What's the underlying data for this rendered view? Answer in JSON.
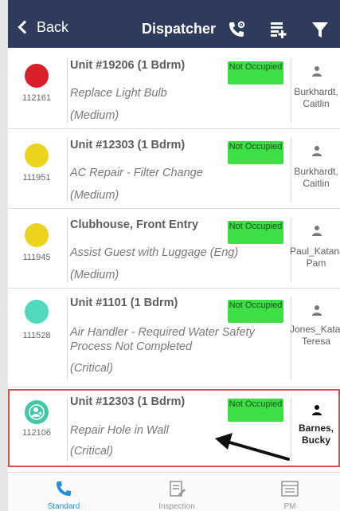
{
  "header": {
    "back_label": "Back",
    "title": "Dispatcher"
  },
  "colors": {
    "header_bg": "#2f3b5c",
    "badge_green": "#3ddf47",
    "accent_blue": "#1f8fdf",
    "selection_red": "#e14a4a"
  },
  "work_orders": [
    {
      "id": "112161",
      "location": "Unit #19206 (1 Bdrm)",
      "description": "Replace Light Bulb",
      "priority": "(Medium)",
      "status": "Not Occupied",
      "assignee": "Burkhardt, Caitlin",
      "dot_color": "#d9202a"
    },
    {
      "id": "111951",
      "location": "Unit #12303 (1 Bdrm)",
      "description": "AC Repair - Filter Change",
      "priority": "(Medium)",
      "status": "Not Occupied",
      "assignee": "Burkhardt, Caitlin",
      "dot_color": "#ecd31c"
    },
    {
      "id": "111945",
      "location": "Clubhouse, Front Entry",
      "description": "Assist Guest with Luggage (Eng)",
      "priority": "(Medium)",
      "status": "Not Occupied",
      "assignee": "Paul_Katana, Pam",
      "dot_color": "#ecd31c"
    },
    {
      "id": "111528",
      "location": "Unit #1101 (1 Bdrm)",
      "description": "Air Handler - Required Water Safety Process Not Completed",
      "priority": "(Critical)",
      "status": "Not Occupied",
      "assignee": "Jones_Katana, Teresa",
      "dot_color": "#4fd9bd"
    },
    {
      "id": "112106",
      "location": "Unit #12303 (1 Bdrm)",
      "description": "Repair Hole in Wall",
      "priority": "(Critical)",
      "status": "Not Occupied",
      "assignee": "Barnes, Bucky",
      "dot_color": "#40c9a6",
      "icon": "person-badge-icon"
    }
  ],
  "tabs": [
    {
      "label": "Standard",
      "icon": "phone-icon",
      "active": true
    },
    {
      "label": "Inspection",
      "icon": "clipboard-icon"
    },
    {
      "label": "PM",
      "icon": "list-icon"
    }
  ],
  "icons": [
    "phone-settings-icon",
    "add-list-icon",
    "filter-icon",
    "person-icon",
    "pointer-arrow"
  ]
}
